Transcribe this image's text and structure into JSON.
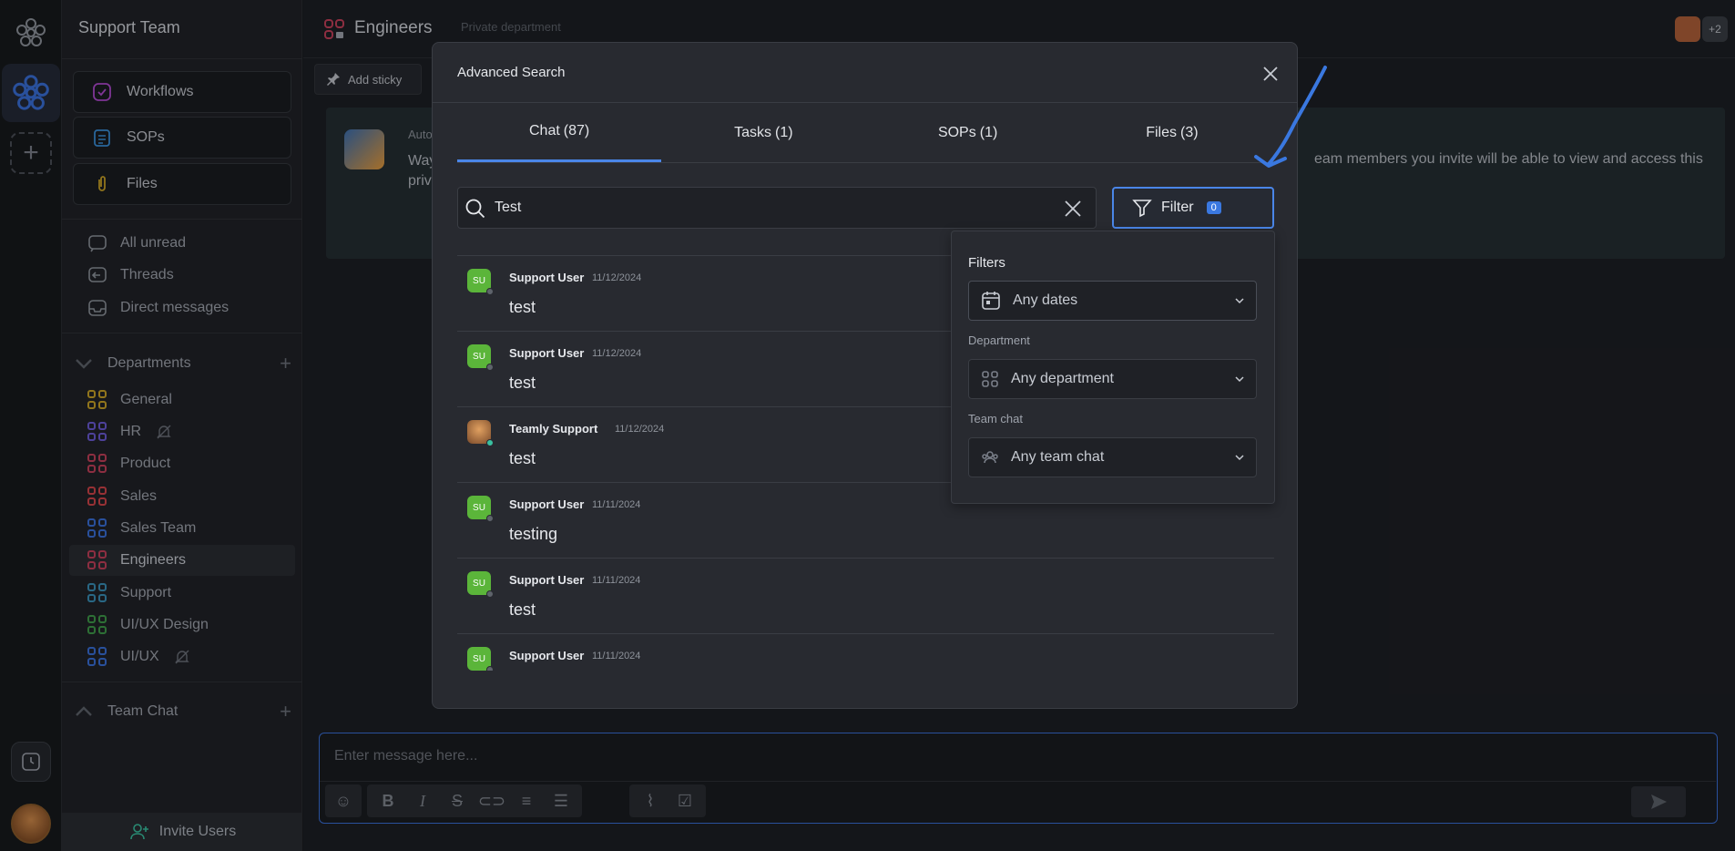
{
  "workspace": {
    "name": "Support Team"
  },
  "sidebar": {
    "nav": [
      {
        "label": "Workflows",
        "icon": "workflow-icon"
      },
      {
        "label": "SOPs",
        "icon": "sop-icon"
      },
      {
        "label": "Files",
        "icon": "paperclip-icon"
      }
    ],
    "links": [
      {
        "label": "All unread",
        "icon": "chat-bubble-icon"
      },
      {
        "label": "Threads",
        "icon": "threads-icon"
      },
      {
        "label": "Direct messages",
        "icon": "inbox-icon"
      }
    ],
    "departments_label": "Departments",
    "departments": [
      {
        "label": "General",
        "color": "#c9a227",
        "muted": false
      },
      {
        "label": "HR",
        "color": "#6b5bd6",
        "muted": true
      },
      {
        "label": "Product",
        "color": "#c4405a",
        "muted": false
      },
      {
        "label": "Sales",
        "color": "#d2454a",
        "muted": false
      },
      {
        "label": "Sales Team",
        "color": "#3a6fd8",
        "muted": false
      },
      {
        "label": "Engineers",
        "color": "#c4405a",
        "muted": false
      },
      {
        "label": "Support",
        "color": "#3a8fb8",
        "muted": false
      },
      {
        "label": "UI/UX Design",
        "color": "#3f9a4a",
        "muted": false
      },
      {
        "label": "UI/UX",
        "color": "#3a6fd8",
        "muted": true
      }
    ],
    "team_chat_label": "Team Chat",
    "invite_label": "Invite Users"
  },
  "header": {
    "department": "Engineers",
    "privacy": "Private department",
    "extra_members": "+2",
    "sticky_label": "Add sticky"
  },
  "banner": {
    "line1": "Auto",
    "line2": "Way priv",
    "line3": "eam members you invite will be able to view and access this"
  },
  "composer": {
    "placeholder": "Enter message here..."
  },
  "modal": {
    "title": "Advanced Search",
    "tabs": [
      {
        "label": "Chat",
        "count": "(87)",
        "active": true
      },
      {
        "label": "Tasks",
        "count": "(1)",
        "active": false
      },
      {
        "label": "SOPs",
        "count": "(1)",
        "active": false
      },
      {
        "label": "Files",
        "count": "(3)",
        "active": false
      }
    ],
    "search_value": "Test",
    "filter_label": "Filter",
    "filter_count": "0",
    "results": [
      {
        "initials": "SU",
        "name": "Support User",
        "date": "11/12/2024",
        "text": "test",
        "online": false
      },
      {
        "initials": "SU",
        "name": "Support User",
        "date": "11/12/2024",
        "text": "test",
        "online": false
      },
      {
        "initials": "",
        "name": "Teamly Support",
        "date": "11/12/2024",
        "text": "test",
        "online": true
      },
      {
        "initials": "SU",
        "name": "Support User",
        "date": "11/11/2024",
        "text": "testing",
        "online": false
      },
      {
        "initials": "SU",
        "name": "Support User",
        "date": "11/11/2024",
        "text": "test",
        "online": false
      },
      {
        "initials": "SU",
        "name": "Support User",
        "date": "11/11/2024",
        "text": "",
        "online": false
      }
    ],
    "filters": {
      "title": "Filters",
      "dates": "Any dates",
      "department_label": "Department",
      "department": "Any department",
      "team_chat_label": "Team chat",
      "team_chat": "Any team chat"
    }
  },
  "colors": {
    "accent": "#4a86e8",
    "online": "#3ac0a0",
    "avatar_green": "#5bb53a"
  }
}
